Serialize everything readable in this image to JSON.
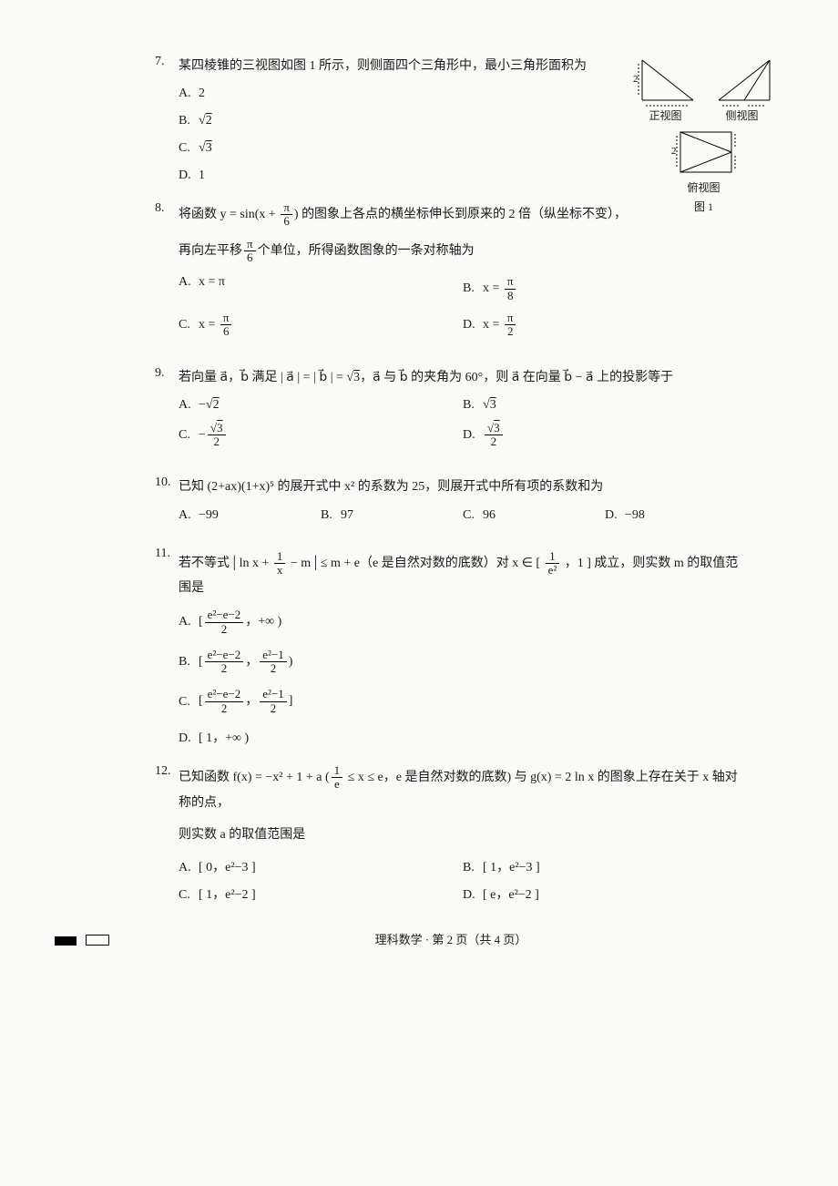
{
  "q7": {
    "num": "7.",
    "stem": "某四棱锥的三视图如图 1 所示，则侧面四个三角形中，最小三角形面积为",
    "A": "2",
    "B_pre": "√",
    "B_rad": "2",
    "C_pre": "√",
    "C_rad": "3",
    "D": "1",
    "fig_front": "正视图",
    "fig_side": "侧视图",
    "fig_top": "俯视图",
    "fig_caption": "图 1"
  },
  "q8": {
    "num": "8.",
    "stem_a": "将函数 y = sin",
    "stem_inner": "x + ",
    "stem_frac_num": "π",
    "stem_frac_den": "6",
    "stem_b": "的图象上各点的横坐标伸长到原来的 2 倍（纵坐标不变），",
    "stem2_a": "再向左平移",
    "stem2_frac_num": "π",
    "stem2_frac_den": "6",
    "stem2_b": "个单位，所得函数图象的一条对称轴为",
    "A": "x = π",
    "B_pre": "x = ",
    "B_num": "π",
    "B_den": "8",
    "C_pre": "x = ",
    "C_num": "π",
    "C_den": "6",
    "D_pre": "x = ",
    "D_num": "π",
    "D_den": "2"
  },
  "q9": {
    "num": "9.",
    "stem_a": "若向量 a⃗，b⃗ 满足 | a⃗ | = | b⃗ | = √",
    "stem_rad": "3",
    "stem_b": "，a⃗ 与 b⃗ 的夹角为 60°，则 a⃗ 在向量 b⃗ − a⃗ 上的投影等于",
    "A_pre": "−√",
    "A_rad": "2",
    "B_pre": "√",
    "B_rad": "3",
    "C_pre": "−",
    "C_num_pre": "√",
    "C_num_rad": "3",
    "C_den": "2",
    "D_num_pre": "√",
    "D_num_rad": "3",
    "D_den": "2"
  },
  "q10": {
    "num": "10.",
    "stem": "已知 (2+ax)(1+x)⁵ 的展开式中 x² 的系数为 25，则展开式中所有项的系数和为",
    "A": "−99",
    "B": "97",
    "C": "96",
    "D": "−98"
  },
  "q11": {
    "num": "11.",
    "stem_a": "若不等式 ",
    "abs_a": "ln x + ",
    "abs_frac_num": "1",
    "abs_frac_den": "x",
    "abs_b": " − m",
    "stem_b": " ≤ m + e（e 是自然对数的底数）对 x ∈ ",
    "rng_num": "1",
    "rng_den": "e²",
    "stem_c": "，1 ] 成立，则实数 m 的取值范围是",
    "A_l": "[",
    "A_a_num": "e²−e−2",
    "A_a_den": "2",
    "A_r": "，+∞ )",
    "B_l": "[",
    "B_a_num": "e²−e−2",
    "B_a_den": "2",
    "B_m": "，",
    "B_b_num": "e²−1",
    "B_b_den": "2",
    "B_r": ")",
    "C_l": "[",
    "C_a_num": "e²−e−2",
    "C_a_den": "2",
    "C_m": "，",
    "C_b_num": "e²−1",
    "C_b_den": "2",
    "C_r": "]",
    "D": "[ 1，+∞ )"
  },
  "q12": {
    "num": "12.",
    "stem_a": "已知函数 f(x) = −x² + 1 + a",
    "rng_num": "1",
    "rng_den": "e",
    "stem_b": " ≤ x ≤ e，e 是自然对数的底数",
    "stem_c": "与 g(x) = 2 ln x 的图象上存在关于 x 轴对称的点，",
    "stem2": "则实数 a 的取值范围是",
    "A": "[ 0，e²−3 ]",
    "B": "[ 1，e²−3 ]",
    "C": "[ 1，e²−2 ]",
    "D": "[ e，e²−2 ]"
  },
  "footer": "理科数学 · 第 2 页（共 4 页）"
}
